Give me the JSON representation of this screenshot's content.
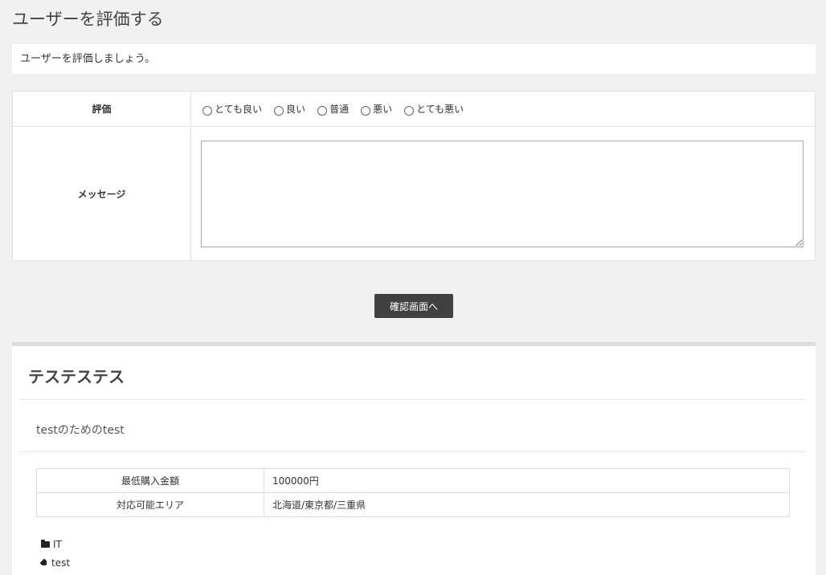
{
  "page": {
    "title": "ユーザーを評価する",
    "intro": "ユーザーを評価しましょう。"
  },
  "form": {
    "rating_label": "評価",
    "rating_options": [
      "とても良い",
      "良い",
      "普通",
      "悪い",
      "とても悪い"
    ],
    "message_label": "メッセージ",
    "message_value": "",
    "confirm_button": "確認画面へ"
  },
  "card": {
    "title": "テステステス",
    "description": "testのためのtest",
    "details": [
      {
        "label": "最低購入金額",
        "value": "100000円"
      },
      {
        "label": "対応可能エリア",
        "value": "北海道/東京都/三重県"
      }
    ],
    "category": "IT",
    "tag": "test",
    "category_icon": "folder-icon",
    "tag_icon": "tag-icon"
  }
}
